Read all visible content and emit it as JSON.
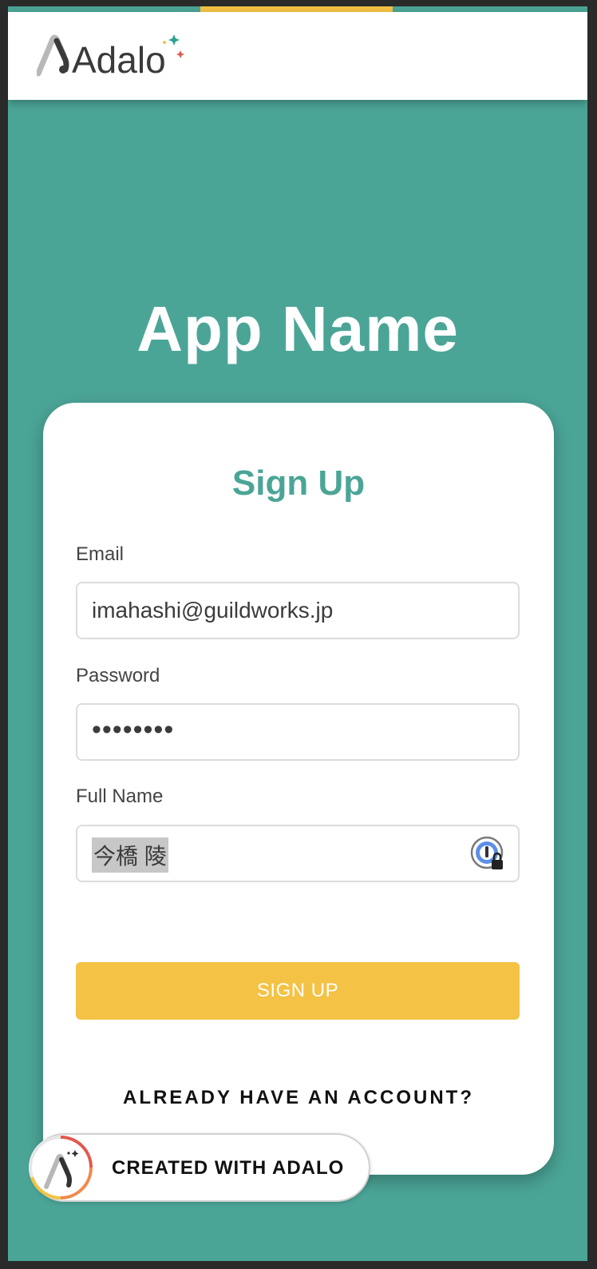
{
  "header": {
    "logo_text": "Adalo"
  },
  "app_name": "App Name",
  "form": {
    "title": "Sign Up",
    "email": {
      "label": "Email",
      "value": "imahashi@guildworks.jp"
    },
    "password": {
      "label": "Password",
      "value": "••••••••"
    },
    "full_name": {
      "label": "Full Name",
      "value": "今橋 陵"
    },
    "submit_label": "SIGN UP",
    "login_link": "ALREADY HAVE AN ACCOUNT?"
  },
  "badge": {
    "label": "CREATED WITH ADALO"
  },
  "colors": {
    "primary": "#4ba597",
    "accent": "#f4c244",
    "card": "#ffffff"
  }
}
